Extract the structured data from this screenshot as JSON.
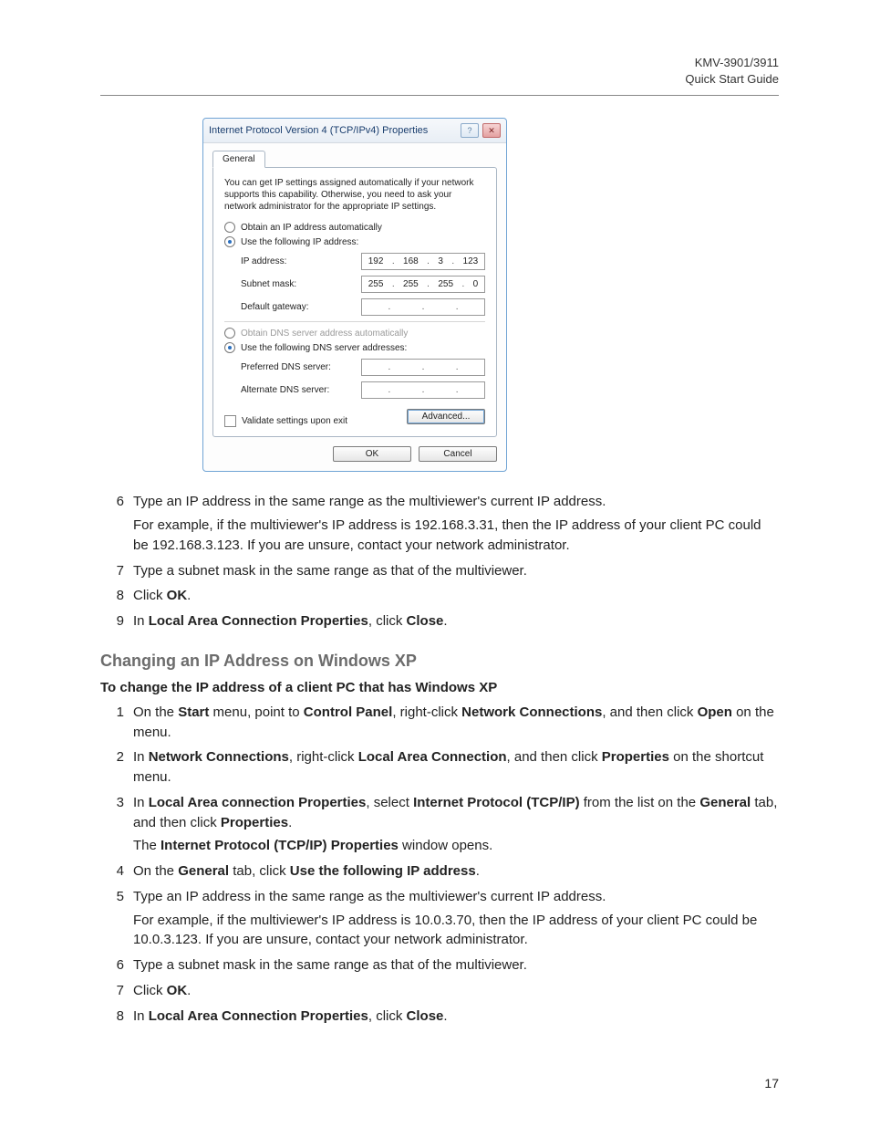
{
  "header": {
    "line1": "KMV-3901/3911",
    "line2": "Quick Start Guide"
  },
  "dialog": {
    "title": "Internet Protocol Version 4 (TCP/IPv4) Properties",
    "tab": "General",
    "description": "You can get IP settings assigned automatically if your network supports this capability. Otherwise, you need to ask your network administrator for the appropriate IP settings.",
    "radio_auto_ip": "Obtain an IP address automatically",
    "radio_use_ip": "Use the following IP address:",
    "lbl_ip": "IP address:",
    "val_ip": [
      "192",
      "168",
      "3",
      "123"
    ],
    "lbl_mask": "Subnet mask:",
    "val_mask": [
      "255",
      "255",
      "255",
      "0"
    ],
    "lbl_gateway": "Default gateway:",
    "radio_auto_dns": "Obtain DNS server address automatically",
    "radio_use_dns": "Use the following DNS server addresses:",
    "lbl_pref_dns": "Preferred DNS server:",
    "lbl_alt_dns": "Alternate DNS server:",
    "check_validate": "Validate settings upon exit",
    "btn_advanced": "Advanced...",
    "btn_ok": "OK",
    "btn_cancel": "Cancel"
  },
  "steps_a": [
    {
      "n": "6",
      "segs": [
        {
          "t": "Type an IP address in the same range as the multiviewer's current IP address."
        }
      ],
      "sub": [
        {
          "t": "For example, if the multiviewer's IP address is 192.168.3.31, then the IP address of your client PC could be 192.168.3.123. If you are unsure, contact your network administrator."
        }
      ]
    },
    {
      "n": "7",
      "segs": [
        {
          "t": "Type a subnet mask in the same range as that of the multiviewer."
        }
      ]
    },
    {
      "n": "8",
      "segs": [
        {
          "t": "Click "
        },
        {
          "b": "OK"
        },
        {
          "t": "."
        }
      ]
    },
    {
      "n": "9",
      "segs": [
        {
          "t": "In "
        },
        {
          "b": "Local Area Connection Properties"
        },
        {
          "t": ", click "
        },
        {
          "b": "Close"
        },
        {
          "t": "."
        }
      ]
    }
  ],
  "section_title": "Changing an IP Address on Windows XP",
  "lead": "To change the IP address of a client PC that has Windows XP",
  "steps_b": [
    {
      "n": "1",
      "segs": [
        {
          "t": "On the "
        },
        {
          "b": "Start"
        },
        {
          "t": " menu, point to "
        },
        {
          "b": "Control Panel"
        },
        {
          "t": ", right-click "
        },
        {
          "b": "Network Connections"
        },
        {
          "t": ", and then click "
        },
        {
          "b": "Open"
        },
        {
          "t": " on the menu."
        }
      ]
    },
    {
      "n": "2",
      "segs": [
        {
          "t": "In "
        },
        {
          "b": "Network Connections"
        },
        {
          "t": ", right-click "
        },
        {
          "b": "Local Area Connection"
        },
        {
          "t": ", and then click "
        },
        {
          "b": "Properties"
        },
        {
          "t": " on the shortcut menu."
        }
      ]
    },
    {
      "n": "3",
      "segs": [
        {
          "t": "In "
        },
        {
          "b": "Local Area connection Properties"
        },
        {
          "t": ", select "
        },
        {
          "b": "Internet Protocol (TCP/IP)"
        },
        {
          "t": " from the list on the "
        },
        {
          "b": "General"
        },
        {
          "t": " tab, and then click "
        },
        {
          "b": "Properties"
        },
        {
          "t": "."
        }
      ],
      "sub": [
        {
          "t": "The "
        },
        {
          "b": "Internet Protocol (TCP/IP) Properties"
        },
        {
          "t": " window opens."
        }
      ]
    },
    {
      "n": "4",
      "segs": [
        {
          "t": "On the "
        },
        {
          "b": "General"
        },
        {
          "t": " tab, click "
        },
        {
          "b": "Use the following IP address"
        },
        {
          "t": "."
        }
      ]
    },
    {
      "n": "5",
      "segs": [
        {
          "t": "Type an IP address in the same range as the multiviewer's current IP address."
        }
      ],
      "sub": [
        {
          "t": "For example, if the multiviewer's IP address is 10.0.3.70, then the IP address of your client PC could be 10.0.3.123. If you are unsure, contact your network administrator."
        }
      ]
    },
    {
      "n": "6",
      "segs": [
        {
          "t": "Type a subnet mask in the same range as that of the multiviewer."
        }
      ]
    },
    {
      "n": "7",
      "segs": [
        {
          "t": "Click "
        },
        {
          "b": "OK"
        },
        {
          "t": "."
        }
      ]
    },
    {
      "n": "8",
      "segs": [
        {
          "t": "In "
        },
        {
          "b": "Local Area Connection Properties"
        },
        {
          "t": ", click "
        },
        {
          "b": "Close"
        },
        {
          "t": "."
        }
      ]
    }
  ],
  "page_number": "17"
}
